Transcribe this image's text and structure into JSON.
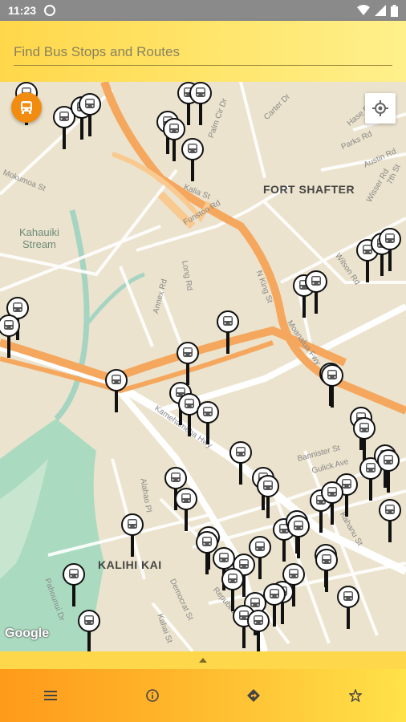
{
  "status_bar": {
    "time": "11:23"
  },
  "search": {
    "placeholder": "Find Bus Stops and Routes"
  },
  "map": {
    "area_labels": [
      "FORT SHAFTER",
      "KALIHI KAI"
    ],
    "water_labels": [
      "Kahauiki\nStream"
    ],
    "street_labels": [
      "Kalia St",
      "Funston Rd",
      "N King St",
      "Moanalua Fwy",
      "Wilson Rd",
      "Parks Rd",
      "Austin Rd",
      "Carter Dr",
      "Mokumoa St",
      "Long Rd",
      "Annex Rd",
      "Kamehameha Hwy",
      "Bannister St",
      "Gulick Ave",
      "Kahanu St",
      "Democrat St",
      "Republican St",
      "Pahounui Dr",
      "Alahao Pl",
      "Kahai St",
      "Palm Cir Dr",
      "Hase Dr",
      "Wisser Rd",
      "7th St"
    ],
    "attribution": "Google"
  },
  "icons": {
    "bus_fab": "bus-icon",
    "locate": "my-location-icon",
    "nav": [
      "menu-icon",
      "info-icon",
      "directions-icon",
      "star-icon"
    ]
  },
  "colors": {
    "accent_orange": "#f28c10",
    "header_yellow": "#ffd74a",
    "freeway": "#f5a75e"
  }
}
